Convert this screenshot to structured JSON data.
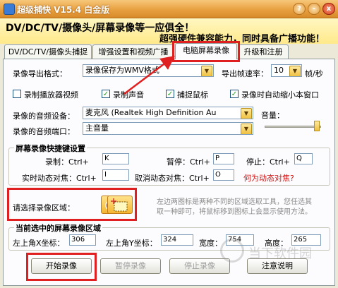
{
  "window": {
    "title": "超级捕快 V15.4 白金版",
    "buttons": [
      "?",
      "-",
      "x"
    ]
  },
  "banner": {
    "line1": "DV/DC/TV/摄像头/屏幕录像等一应俱全！",
    "line2": "超强硬件兼容能力，同时具备广播功能！"
  },
  "tabs": [
    {
      "label": "DV/DC/TV/摄像头捕捉"
    },
    {
      "label": "增强设置和视频广播"
    },
    {
      "label": "电脑屏幕录像"
    },
    {
      "label": "升级和注册"
    }
  ],
  "export": {
    "format_label": "录像导出格式：",
    "format_value": "录像保存为WMV格式",
    "fps_label": "导出帧速率：",
    "fps_value": "10",
    "fps_unit": "帧/秒"
  },
  "options": {
    "record_player": {
      "label": "录制播放器视频",
      "checked": false
    },
    "record_sound": {
      "label": "录制声音",
      "checked": true
    },
    "capture_mouse": {
      "label": "捕捉鼠标",
      "checked": true
    },
    "minimize": {
      "label": "录像时自动缩小本窗口",
      "checked": true
    }
  },
  "audio": {
    "device_label": "录像的音频设备：",
    "device_value": "麦克风 (Realtek High Definition Au",
    "port_label": "录像的音频端口：",
    "port_value": "主音量",
    "volume_label": "音量：",
    "volume_level": 0.92
  },
  "hotkeys": {
    "title": "屏幕录像快捷键设置",
    "record_label": "录制：Ctrl+",
    "record_key": "K",
    "pause_label": "暂停：Ctrl+",
    "pause_key": "P",
    "stop_label": "停止：Ctrl+",
    "stop_key": "Q",
    "focus_label": "实时动态对焦：Ctrl+",
    "focus_key": "I",
    "cancel_focus_label": "取消动态对焦：Ctrl+",
    "cancel_focus_key": "O",
    "help_link": "何为动态对焦?"
  },
  "region": {
    "label": "请选择录像区域：",
    "hint_line1": "左边两图标是两种不同的区域选取工具，您任选其",
    "hint_line2": "取一种即可，将鼠标移到图标上会显示使用方法。"
  },
  "coords": {
    "title": "当前选中的屏幕录像区域",
    "x_label": "左上角X坐标：",
    "x_value": "306",
    "y_label": "左上角Y坐标：",
    "y_value": "324",
    "w_label": "宽度：",
    "w_value": "754",
    "h_label": "高度：",
    "h_value": "265"
  },
  "actions": {
    "start": "开始录像",
    "pause": "暂停录像",
    "stop": "停止录像",
    "notes": "注意说明"
  },
  "colors": {
    "highlight_box": "#e02020",
    "help_link": "#d01010",
    "check_mark": "#21a121"
  }
}
